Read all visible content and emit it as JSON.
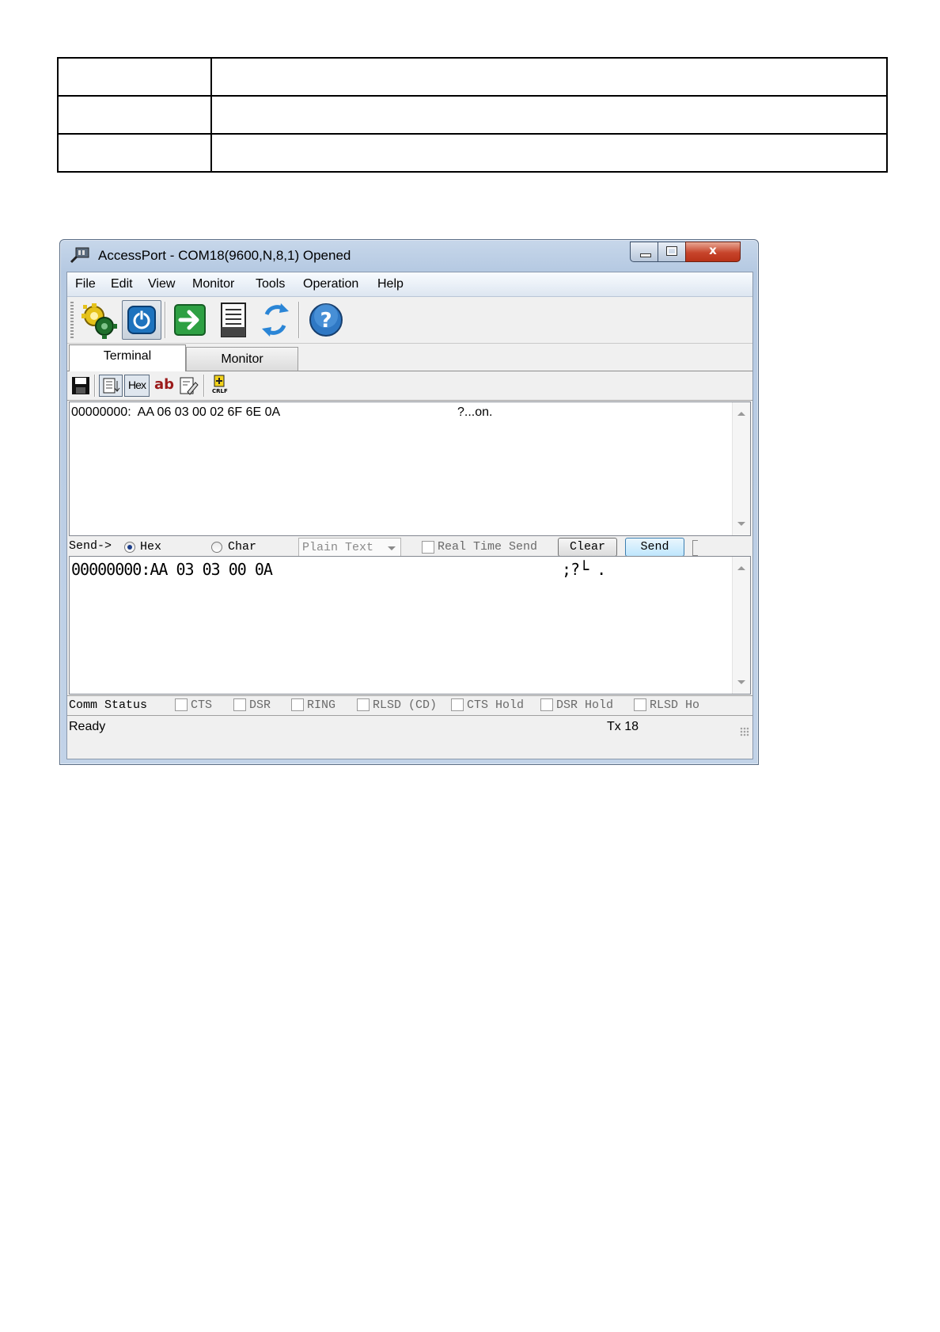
{
  "window": {
    "title": "AccessPort - COM18(9600,N,8,1) Opened",
    "close_glyph": "x"
  },
  "menu": [
    "File",
    "Edit",
    "View",
    "Monitor",
    "Tools",
    "Operation",
    "Help"
  ],
  "toolbar_icons": [
    "settings-gears-icon",
    "power-icon",
    "go-arrow-icon",
    "document-icon",
    "refresh-icon",
    "help-icon"
  ],
  "tabs": {
    "terminal": "Terminal",
    "monitor": "Monitor"
  },
  "mini_toolbar": {
    "hex": "Hex",
    "ab": "ab",
    "crlf": "CRLF"
  },
  "receive": {
    "line": "00000000:  AA 06 03 00 02 6F 6E 0A",
    "ascii": "?...on."
  },
  "send_bar": {
    "label": "Send->",
    "hex_label": "Hex",
    "char_label": "Char",
    "selected": "Hex",
    "format_value": "Plain Text",
    "realtime_label": "Real Time Send",
    "clear_label": "Clear",
    "send_label": "Send"
  },
  "transmit": {
    "line": "00000000:AA 03 03 00 0A",
    "ascii": ";?└ ."
  },
  "comm_status": {
    "label": "Comm Status",
    "signals": [
      "CTS",
      "DSR",
      "RING",
      "RLSD (CD)",
      "CTS Hold",
      "DSR Hold",
      "RLSD Ho"
    ]
  },
  "status": {
    "left": "Ready",
    "right": "Tx 18"
  },
  "colors": {
    "accent": "#3c7fb1",
    "close_button": "#c7442b"
  }
}
